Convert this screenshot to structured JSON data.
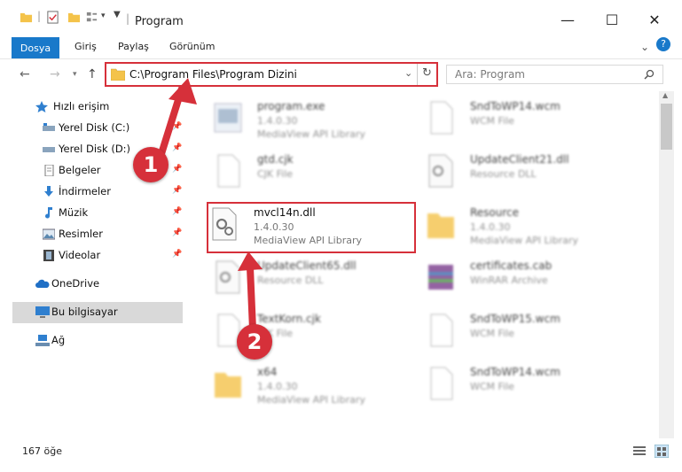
{
  "window": {
    "title": "Program",
    "controls": {
      "minimize": "—",
      "maximize": "☐",
      "close": "✕"
    }
  },
  "ribbon": {
    "tabs": [
      "Dosya",
      "Giriş",
      "Paylaş",
      "Görünüm"
    ]
  },
  "address": {
    "path": "C:\\Program Files\\Program Dizini"
  },
  "search": {
    "placeholder": "Ara: Program"
  },
  "sidebar": {
    "items": [
      {
        "label": "Hızlı erişim"
      },
      {
        "label": "Yerel Disk (C:)"
      },
      {
        "label": "Yerel Disk (D:)"
      },
      {
        "label": "Belgeler"
      },
      {
        "label": "İndirmeler"
      },
      {
        "label": "Müzik"
      },
      {
        "label": "Resimler"
      },
      {
        "label": "Videolar"
      },
      {
        "label": "OneDrive"
      },
      {
        "label": "Bu bilgisayar"
      },
      {
        "label": "Ağ"
      }
    ]
  },
  "files": [
    {
      "name": "program.exe",
      "l2": "1.4.0.30",
      "l3": "MediaView API Library"
    },
    {
      "name": "SndToWP14.wcm",
      "l2": "WCM File",
      "l3": ""
    },
    {
      "name": "gtd.cjk",
      "l2": "CJK File",
      "l3": ""
    },
    {
      "name": "UpdateClient21.dll",
      "l2": "Resource DLL",
      "l3": ""
    },
    {
      "name": "mvcl14n.dll",
      "l2": "1.4.0.30",
      "l3": "MediaView API Library"
    },
    {
      "name": "Resource",
      "l2": "1.4.0.30",
      "l3": "MediaView API Library"
    },
    {
      "name": "UpdateClient65.dll",
      "l2": "Resource DLL",
      "l3": ""
    },
    {
      "name": "certificates.cab",
      "l2": "WinRAR Archive",
      "l3": ""
    },
    {
      "name": "TextKorn.cjk",
      "l2": "CJK File",
      "l3": ""
    },
    {
      "name": "SndToWP15.wcm",
      "l2": "WCM File",
      "l3": ""
    },
    {
      "name": "x64",
      "l2": "1.4.0.30",
      "l3": "MediaView API Library"
    },
    {
      "name": "SndToWP14.wcm",
      "l2": "WCM File",
      "l3": ""
    }
  ],
  "status": {
    "count": "167 öğe"
  },
  "annotations": {
    "one": "1",
    "two": "2"
  },
  "colors": {
    "accent": "#1979ca",
    "highlight": "#d6303a"
  }
}
